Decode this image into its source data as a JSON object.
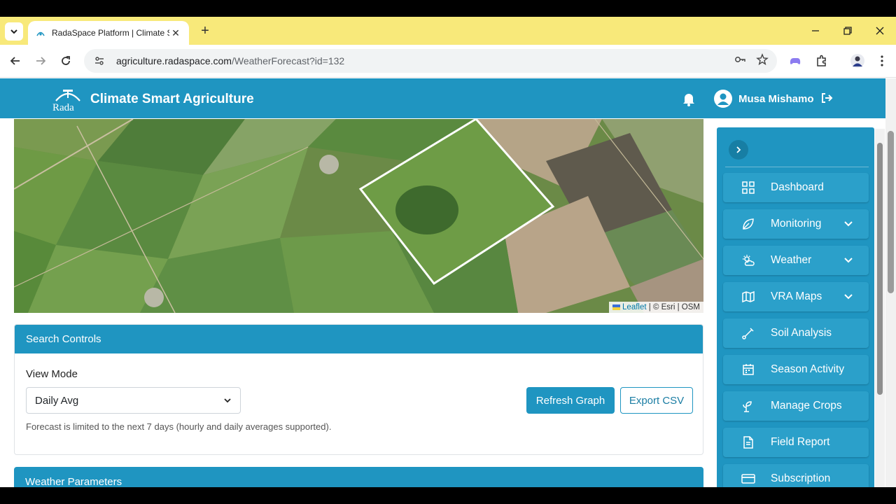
{
  "browser": {
    "tab_title": "RadaSpace Platform | Climate S",
    "url_host": "agriculture.radaspace.com",
    "url_path": "/WeatherForecast?id=132"
  },
  "header": {
    "logo_text": "Rada",
    "title": "Climate Smart Agriculture",
    "user_name": "Musa Mishamo"
  },
  "map": {
    "attribution_leaflet": "Leaflet",
    "attribution_rest": " | © Esri | OSM"
  },
  "search_controls": {
    "heading": "Search Controls",
    "view_mode_label": "View Mode",
    "view_mode_value": "Daily Avg",
    "refresh_label": "Refresh Graph",
    "export_label": "Export CSV",
    "hint": "Forecast is limited to the next 7 days (hourly and daily averages supported)."
  },
  "weather_parameters": {
    "heading": "Weather Parameters"
  },
  "sidebar": {
    "items": [
      {
        "label": "Dashboard",
        "icon": "grid-icon"
      },
      {
        "label": "Monitoring",
        "icon": "leaf-icon"
      },
      {
        "label": "Weather",
        "icon": "sun-cloud-icon"
      },
      {
        "label": "VRA Maps",
        "icon": "map-icon"
      },
      {
        "label": "Soil Analysis",
        "icon": "probe-icon"
      },
      {
        "label": "Season Activity",
        "icon": "calendar-icon"
      },
      {
        "label": "Manage Crops",
        "icon": "sprout-icon"
      },
      {
        "label": "Field Report",
        "icon": "document-icon"
      },
      {
        "label": "Subscription",
        "icon": "card-icon"
      }
    ]
  },
  "colors": {
    "brand": "#1f95c1",
    "tab_strip": "#f8e97a"
  }
}
